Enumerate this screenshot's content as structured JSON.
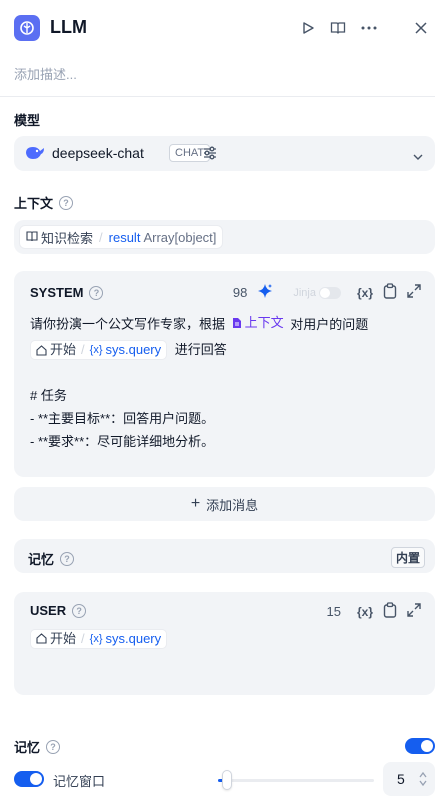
{
  "header": {
    "title": "LLM",
    "description_placeholder": "添加描述..."
  },
  "model": {
    "label": "模型",
    "name": "deepseek-chat",
    "mode": "CHAT"
  },
  "context": {
    "label": "上下文",
    "source": "知识检索",
    "separator": "/",
    "var": "result",
    "type": "Array[object]"
  },
  "system": {
    "role": "SYSTEM",
    "tokens": "98",
    "jinja": "Jinja",
    "var_button": "{x}",
    "line1_a": "请你扮演一个公文写作专家，根据",
    "line1_ctx": "上下文",
    "line1_b": "对用户的问题",
    "line2_node": "开始",
    "line2_var": "sys.query",
    "line2_b": "进行回答",
    "line3": "# 任务",
    "line4": "- **主要目标**：回答用户问题。",
    "line5": "- **要求**：尽可能详细地分析。"
  },
  "add_message": {
    "label": "添加消息"
  },
  "memory_inline": {
    "label": "记忆",
    "badge": "内置"
  },
  "user": {
    "role": "USER",
    "tokens": "15",
    "var_button": "{x}",
    "node": "开始",
    "var": "sys.query"
  },
  "memory": {
    "label": "记忆",
    "window_label": "记忆窗口",
    "window_value": "5",
    "enabled": true,
    "window_enabled": true
  },
  "colors": {
    "accent": "#155eef",
    "logo": "#5b6ff2",
    "panel": "#f2f4f7",
    "context_var": "#6938ef"
  }
}
